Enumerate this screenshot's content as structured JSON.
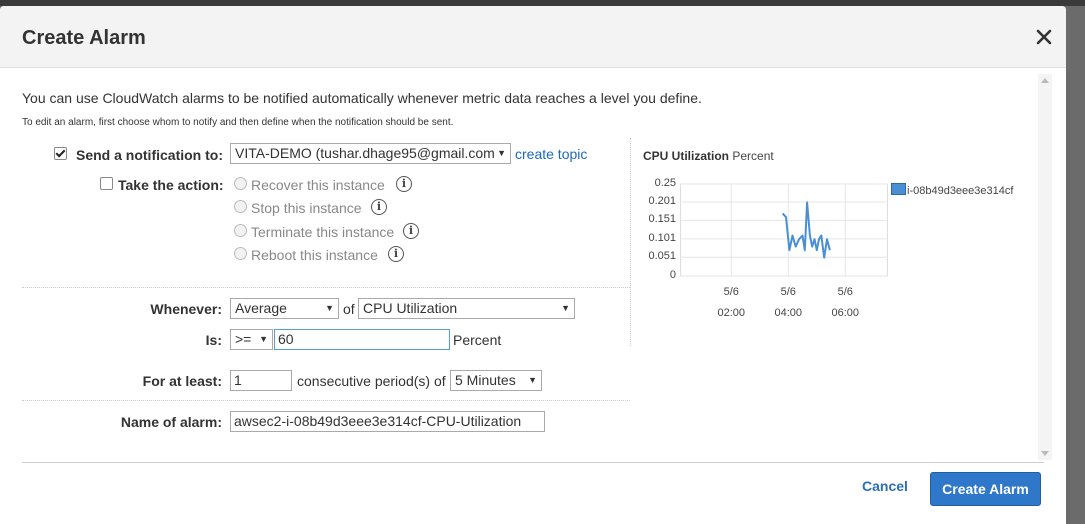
{
  "dialog": {
    "title": "Create Alarm",
    "intro": "You can use CloudWatch alarms to be notified automatically whenever metric data reaches a level you define.",
    "intro_small": "To edit an alarm, first choose whom to notify and then define when the notification should be sent."
  },
  "notification": {
    "label": "Send a notification to:",
    "checked": true,
    "topic_value": "VITA-DEMO (tushar.dhage95@gmail.com",
    "create_topic_link": "create topic"
  },
  "action": {
    "label": "Take the action:",
    "checked": false,
    "options": [
      "Recover this instance",
      "Stop this instance",
      "Terminate this instance",
      "Reboot this instance"
    ],
    "info_glyph": "i"
  },
  "whenever": {
    "label": "Whenever:",
    "statistic": "Average",
    "of_text": "of",
    "metric": "CPU Utilization"
  },
  "threshold": {
    "label": "Is:",
    "operator": ">=",
    "value": "60",
    "unit": "Percent"
  },
  "period": {
    "label": "For at least:",
    "count": "1",
    "text": "consecutive period(s) of",
    "duration": "5 Minutes"
  },
  "alarm_name": {
    "label": "Name of alarm:",
    "value": "awsec2-i-08b49d3eee3e314cf-CPU-Utilization"
  },
  "footer": {
    "cancel_label": "Cancel",
    "create_label": "Create Alarm"
  },
  "icons": {
    "close": "close-icon",
    "info": "info-icon",
    "dropdown": "chevron-down-icon"
  },
  "colors": {
    "primary_button": "#2f77c8",
    "link": "#1a6bb8",
    "series": "#4a8fd4"
  },
  "chart_data": {
    "type": "line",
    "title": "CPU Utilization",
    "unit_label": "Percent",
    "y_ticks": [
      "0.25",
      "0.201",
      "0.151",
      "0.101",
      "0.051",
      "0"
    ],
    "ylim": [
      0,
      0.25
    ],
    "x_ticks": [
      {
        "date": "5/6",
        "time": "02:00",
        "hour": 2
      },
      {
        "date": "5/6",
        "time": "04:00",
        "hour": 4
      },
      {
        "date": "5/6",
        "time": "06:00",
        "hour": 6
      }
    ],
    "xlim": [
      0.2,
      7.5
    ],
    "grid": true,
    "legend_position": "right",
    "series": [
      {
        "name": "i-08b49d3eee3e314cf",
        "points": [
          [
            3.8,
            0.17
          ],
          [
            3.92,
            0.16
          ],
          [
            4.04,
            0.07
          ],
          [
            4.15,
            0.11
          ],
          [
            4.26,
            0.08
          ],
          [
            4.38,
            0.1
          ],
          [
            4.5,
            0.11
          ],
          [
            4.58,
            0.07
          ],
          [
            4.66,
            0.2
          ],
          [
            4.76,
            0.11
          ],
          [
            4.84,
            0.08
          ],
          [
            4.92,
            0.1
          ],
          [
            5.0,
            0.07
          ],
          [
            5.08,
            0.1
          ],
          [
            5.16,
            0.11
          ],
          [
            5.26,
            0.05
          ],
          [
            5.36,
            0.1
          ],
          [
            5.46,
            0.07
          ]
        ]
      }
    ]
  }
}
